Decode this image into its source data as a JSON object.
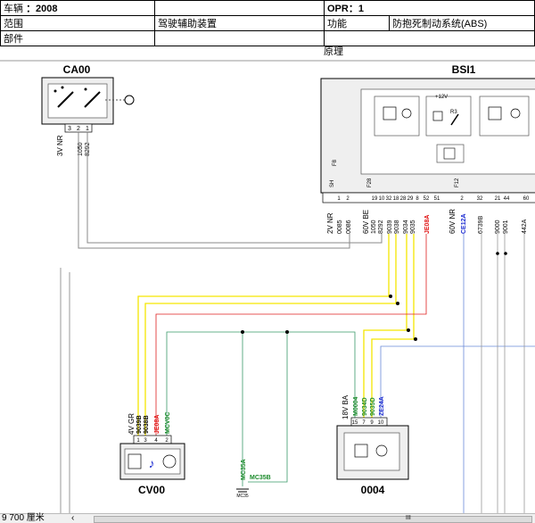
{
  "header": {
    "vehicle_label": "车辆",
    "vehicle_value": "：2008",
    "opr_label": "OPR：1",
    "scope_label": "范围",
    "scope_value": "驾驶辅助装置",
    "function_label": "功能",
    "function_value": "防抱死制动系统(ABS)",
    "part_label": "部件"
  },
  "principle": "原理",
  "components": {
    "ca00": {
      "name": "CA00",
      "pins": [
        "3",
        "2",
        "1"
      ],
      "conn": "3V NR",
      "wires": [
        "1050",
        "8292"
      ]
    },
    "bsi1": {
      "name": "BSI1",
      "v12": "+12V",
      "r3": "R3",
      "f8": "F8",
      "sh": "SH",
      "f28": "F28",
      "f12": "F12",
      "conn_a": "2V NR",
      "conn_b": "60V BE",
      "conn_c": "60V NR",
      "pins": [
        "1",
        "2",
        "19",
        "10",
        "32",
        "18",
        "28",
        "29",
        "8",
        "52",
        "51",
        "2",
        "32",
        "21",
        "44",
        "60"
      ],
      "wires": [
        "0085",
        "0086",
        "1050",
        "8292",
        "9039",
        "9038",
        "9034",
        "9035",
        "JE08A",
        "CE12A",
        "6739B",
        "9000",
        "9001",
        "442A"
      ]
    },
    "cv00": {
      "name": "CV00",
      "conn": "4V GR",
      "pins": [
        "1",
        "3",
        "4",
        "2"
      ],
      "wires": [
        "9039B",
        "9038B",
        "JE08A",
        "MCV0C"
      ]
    },
    "c0004": {
      "name": "0004",
      "conn": "18V BA",
      "pins": [
        "15",
        "7",
        "9",
        "10"
      ],
      "wires": [
        "M0004",
        "9034D",
        "9035D",
        "ZE24A"
      ]
    },
    "mc35": {
      "name": "MC35",
      "wires": [
        "MC35A",
        "MC35B"
      ]
    }
  },
  "statusbar": {
    "scale": "9 700 厘米",
    "left_arrow": "‹",
    "scroll": "III"
  },
  "colors": {
    "yellow": "#f5e600",
    "red": "#e02020",
    "green_wire": "#3a9a6a",
    "blue_wire": "#6a8ad8",
    "grey_wire": "#8a8a8a",
    "wire_green_text": "#1a8a2a",
    "wire_red_text": "#e01010",
    "wire_blue_text": "#1a2ad0"
  }
}
